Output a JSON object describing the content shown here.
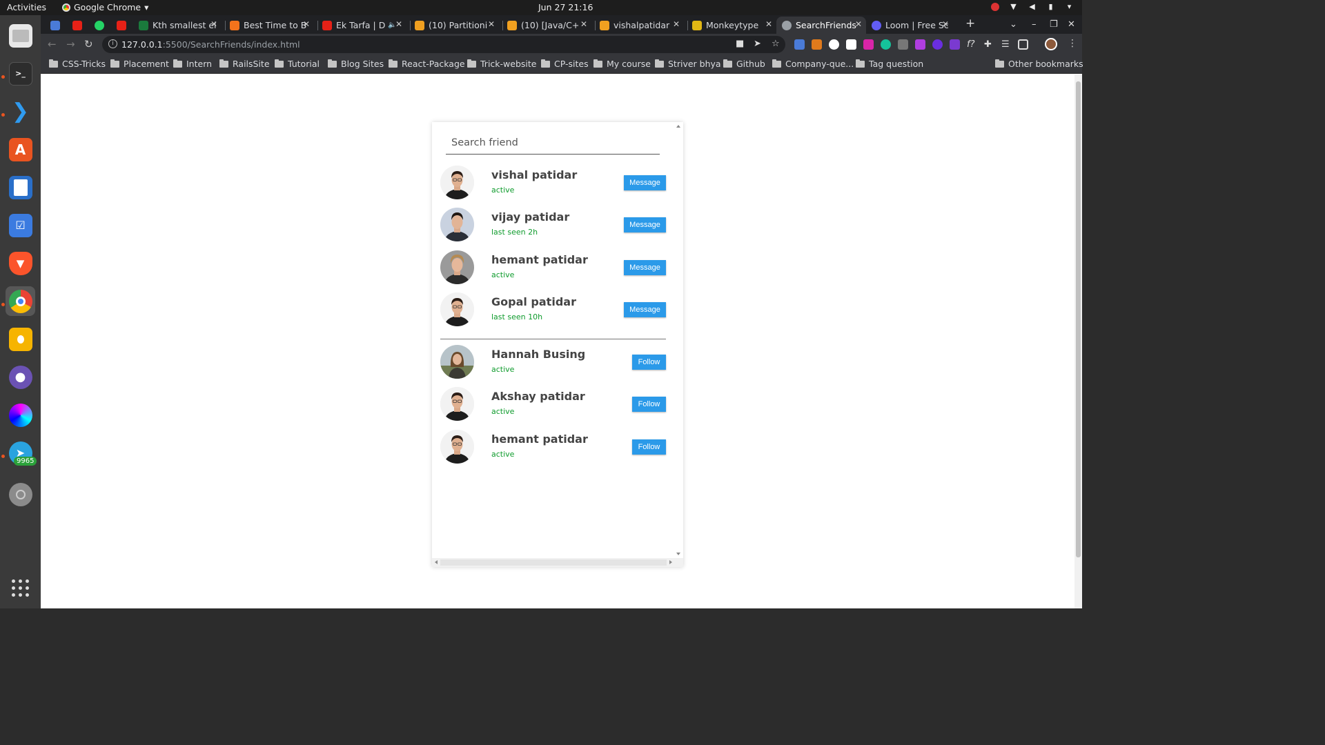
{
  "topbar": {
    "activities": "Activities",
    "app_name": "Google Chrome",
    "clock": "Jun 27  21:16"
  },
  "dock": {
    "badge": "9965"
  },
  "tabs": [
    {
      "title": "Kth smallest el",
      "color": "#1a7a3c"
    },
    {
      "title": "Best Time to B",
      "color": "#f4731c"
    },
    {
      "title": "Ek Tarfa | D",
      "color": "#e62117"
    },
    {
      "title": "(10) Partitioni",
      "color": "#f0a020"
    },
    {
      "title": "(10) [Java/C+",
      "color": "#f0a020"
    },
    {
      "title": "vishalpatidar",
      "color": "#f0a020"
    },
    {
      "title": "Monkeytype",
      "color": "#e2b714"
    },
    {
      "title": "SearchFriends",
      "color": "#9aa0a6"
    },
    {
      "title": "Loom | Free Sc",
      "color": "#625df5"
    }
  ],
  "address": {
    "host": "127.0.0.1",
    "path": ":5500/SearchFriends/index.html"
  },
  "bookmarks": [
    "CSS-Tricks",
    "Placement",
    "Intern",
    "RailsSite",
    "Tutorial",
    "Blog Sites",
    "React-Package",
    "Trick-website",
    "CP-sites",
    "My course",
    "Striver bhya",
    "Github",
    "Company-que...",
    "Tag question"
  ],
  "other_bookmarks": "Other bookmarks",
  "search": {
    "placeholder": "Search friend"
  },
  "friends": [
    {
      "name": "vishal patidar",
      "status": "active",
      "button": "Message",
      "avatar": "man-dark-hair"
    },
    {
      "name": "vijay patidar",
      "status": "last seen 2h",
      "button": "Message",
      "avatar": "man-blue-bg"
    },
    {
      "name": "hemant patidar",
      "status": "active",
      "button": "Message",
      "avatar": "man-blond"
    },
    {
      "name": "Gopal patidar",
      "status": "last seen 10h",
      "button": "Message",
      "avatar": "man-dark-hair"
    }
  ],
  "suggestions": [
    {
      "name": "Hannah Busing",
      "status": "active",
      "button": "Follow",
      "avatar": "woman-outdoor"
    },
    {
      "name": "Akshay patidar",
      "status": "active",
      "button": "Follow",
      "avatar": "man-dark-hair"
    },
    {
      "name": "hemant patidar",
      "status": "active",
      "button": "Follow",
      "avatar": "man-dark-hair"
    }
  ],
  "colors": {
    "accent_button": "#2b9ae9",
    "status_green": "#0e9b2c",
    "name_text": "#444444"
  }
}
